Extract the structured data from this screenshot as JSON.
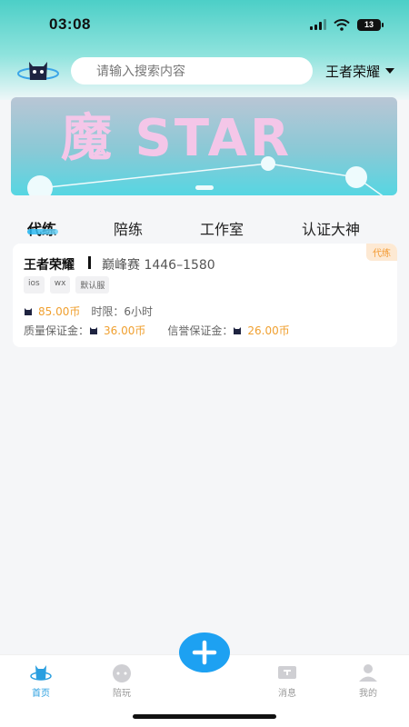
{
  "status": {
    "time": "03:08",
    "battery": "13"
  },
  "header": {
    "search_placeholder": "请输入搜索内容",
    "game": "王者荣耀"
  },
  "banner": {
    "text": "魔 STAR"
  },
  "tabs": [
    {
      "label": "代练",
      "active": true
    },
    {
      "label": "陪练",
      "active": false
    },
    {
      "label": "工作室",
      "active": false
    },
    {
      "label": "认证大神",
      "active": false
    }
  ],
  "order": {
    "badge": "代练",
    "game": "王者荣耀",
    "rank": "巅峰赛 1446–1580",
    "tags": [
      "ios",
      "wx",
      "默认服"
    ],
    "price": "85.00币",
    "time_limit_label": "时限：",
    "time_limit": "6小时",
    "quality_deposit_label": "质量保证金：",
    "quality_deposit": "36.00币",
    "credit_deposit_label": "信誉保证金：",
    "credit_deposit": "26.00币"
  },
  "bottom_nav": [
    {
      "label": "首页",
      "icon": "home-icon",
      "active": true
    },
    {
      "label": "陪玩",
      "icon": "chat-face-icon",
      "active": false
    },
    {
      "label": "消息",
      "icon": "message-icon",
      "active": false
    },
    {
      "label": "我的",
      "icon": "user-icon",
      "active": false
    }
  ],
  "colors": {
    "accent": "#1da1f2",
    "price": "#f0a030"
  }
}
